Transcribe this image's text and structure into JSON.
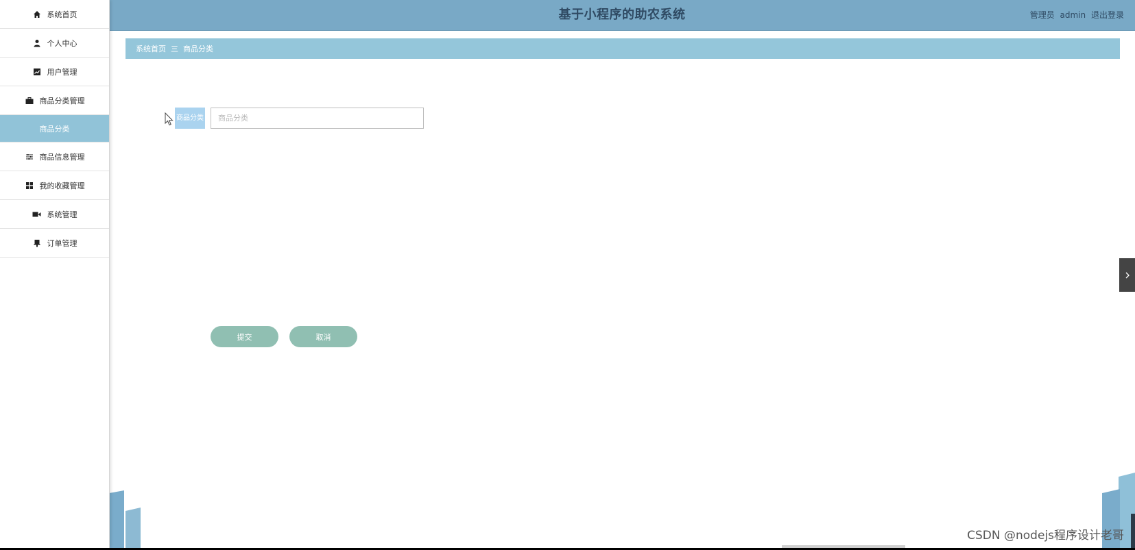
{
  "header": {
    "title": "基于小程序的助农系统",
    "user_role": "管理员",
    "user_name": "admin",
    "logout": "退出登录"
  },
  "sidebar": {
    "items": [
      {
        "label": "系统首页",
        "icon": "home-icon"
      },
      {
        "label": "个人中心",
        "icon": "user-icon"
      },
      {
        "label": "用户管理",
        "icon": "chart-icon"
      },
      {
        "label": "商品分类管理",
        "icon": "briefcase-icon"
      },
      {
        "label": "商品分类",
        "icon": "",
        "active": true
      },
      {
        "label": "商品信息管理",
        "icon": "sliders-icon"
      },
      {
        "label": "我的收藏管理",
        "icon": "grid-icon"
      },
      {
        "label": "系统管理",
        "icon": "video-icon"
      },
      {
        "label": "订单管理",
        "icon": "stamp-icon"
      }
    ]
  },
  "breadcrumb": {
    "home": "系统首页",
    "separator": "三",
    "current": "商品分类"
  },
  "form": {
    "label": "商品分类",
    "placeholder": "商品分类",
    "value": ""
  },
  "buttons": {
    "submit": "提交",
    "cancel": "取消"
  },
  "watermark": "CSDN @nodejs程序设计老哥",
  "colors": {
    "header_bg": "#79a9c6",
    "breadcrumb_bg": "#94c6da",
    "active_item_bg": "#91c3d8",
    "button_bg": "#90bfb2",
    "label_bg": "#aad3ef",
    "title_color": "#2f4a63"
  }
}
